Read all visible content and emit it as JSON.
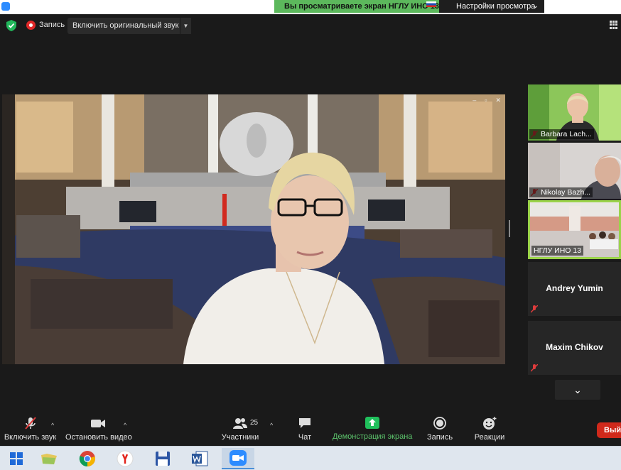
{
  "top_bar": {
    "share_banner": "Вы просматриваете экран НГЛУ ИНО 13",
    "view_settings": "Настройки просмотра"
  },
  "toolbar": {
    "record_label": "Запись",
    "original_sound": "Включить оригинальный звук"
  },
  "participants": [
    {
      "name": "Barbara Lach...",
      "muted": true,
      "video": true
    },
    {
      "name": "Nikolay Bazh...",
      "muted": true,
      "video": true
    },
    {
      "name": "НГЛУ ИНО 13",
      "muted": false,
      "video": true,
      "active_speaker": true
    },
    {
      "name": "Andrey Yumin",
      "muted": true,
      "video": false
    },
    {
      "name": "Maxim Chikov",
      "muted": true,
      "video": false
    }
  ],
  "controls": {
    "unmute": "Включить звук",
    "start_video": "Остановить видео",
    "participants": "Участники",
    "participants_count": "25",
    "chat": "Чат",
    "share_screen": "Демонстрация экрана",
    "record": "Запись",
    "reactions": "Реакции",
    "leave": "Выйти"
  },
  "colors": {
    "share_green": "#5cb85c",
    "active_border": "#9bd34a",
    "leave_red": "#d0291b",
    "record_red": "#e02828"
  },
  "taskbar": {
    "icons": [
      "windows-start-icon",
      "folder-icon",
      "chrome-icon",
      "yandex-icon",
      "save-icon",
      "word-icon",
      "zoom-icon"
    ]
  }
}
